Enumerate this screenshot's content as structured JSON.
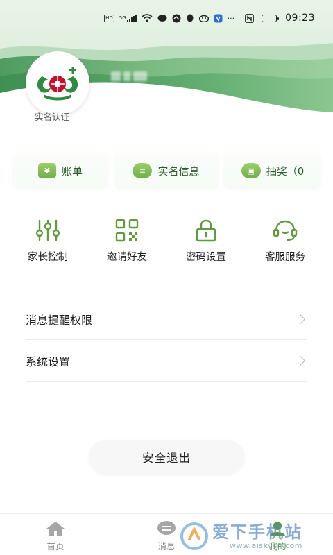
{
  "status_bar": {
    "time": "09:23",
    "network_badge": "HD",
    "network_type": "5G",
    "icons": [
      "hd-badge",
      "signal-icon",
      "wifi-icon",
      "wechat-icon",
      "app-icon",
      "qq-icon",
      "app-icon",
      "app-icon",
      "more-dots",
      "nfc-icon",
      "battery-icon"
    ],
    "more": "···"
  },
  "profile": {
    "avatar_icon": "bank-logo-icon",
    "username_hidden": true,
    "realname_label": "实名认证"
  },
  "summary_cards": [
    {
      "icon": "bill-icon",
      "icon_glyph": "¥",
      "label": "账单"
    },
    {
      "icon": "id-card-icon",
      "icon_glyph": "≡",
      "label": "实名信息"
    },
    {
      "icon": "gift-icon",
      "icon_glyph": "▣",
      "label": "抽奖（0"
    }
  ],
  "quick_actions": [
    {
      "icon": "sliders-icon",
      "label": "家长控制"
    },
    {
      "icon": "qr-code-icon",
      "label": "邀请好友"
    },
    {
      "icon": "lock-icon",
      "label": "密码设置"
    },
    {
      "icon": "headset-icon",
      "label": "客服服务"
    }
  ],
  "settings_list": [
    {
      "label": "消息提醒权限"
    },
    {
      "label": "系统设置"
    }
  ],
  "logout_label": "安全退出",
  "bottom_nav": [
    {
      "icon": "home-icon",
      "label": "首页",
      "active": false
    },
    {
      "icon": "message-icon",
      "label": "消息",
      "active": false
    },
    {
      "icon": "profile-icon",
      "label": "我的",
      "active": true
    }
  ],
  "watermark": {
    "text": "爱下手机站",
    "url": "www.aiskycn.com"
  },
  "colors": {
    "header_green": "#5ea76d",
    "accent_green": "#6fae47",
    "card_text": "#2a5d2c",
    "brand_red": "#c8102e"
  }
}
